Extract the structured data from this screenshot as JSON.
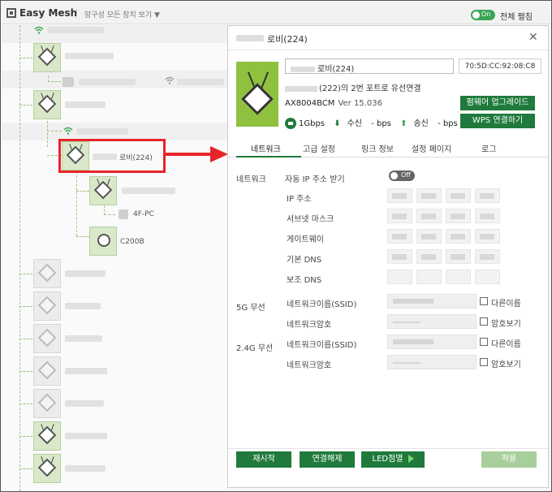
{
  "app": {
    "title": "Easy Mesh",
    "filter_label": "망구성 모든 장치 보기 ▼",
    "toggle_label": "On",
    "expand_all_label": "전체 펼침"
  },
  "tree": {
    "selected_label": "로비(224)",
    "child_label_1": "4F-PC",
    "child_label_2": "C200B"
  },
  "panel": {
    "title": "로비(224)",
    "device_name": "로비(224)",
    "mac": "70:5D:CC:92:08:C8",
    "connection": "(222)의 2번 포트로 유선연결",
    "model": "AX8004BCM",
    "version": "Ver 15.036",
    "firmware_button": "펌웨어 업그레이드",
    "wps_button": "WPS 연결하기",
    "speed": "1Gbps",
    "rx_label": "수신",
    "rx_value": "- bps",
    "tx_label": "송신",
    "tx_value": "- bps",
    "close_icon": "close-icon"
  },
  "tabs": [
    "네트워크",
    "고급 설정",
    "링크 정보",
    "설정 페이지",
    "로그"
  ],
  "network": {
    "section_label": "네트워크",
    "auto_ip_label": "자동 IP 주소 받기",
    "auto_ip_toggle": "Off",
    "ip_label": "IP 주소",
    "subnet_label": "서브넷 마스크",
    "gateway_label": "게이트웨이",
    "dns1_label": "기본 DNS",
    "dns2_label": "보조 DNS"
  },
  "wifi5g": {
    "section_label": "5G 무선",
    "ssid_label": "네트워크이름(SSID)",
    "password_label": "네트워크암호",
    "other_name_label": "다른이름",
    "show_password_label": "암호보기"
  },
  "wifi24g": {
    "section_label": "2.4G 무선",
    "ssid_label": "네트워크이름(SSID)",
    "password_label": "네트워크암호",
    "other_name_label": "다른이름",
    "show_password_label": "암호보기"
  },
  "footer": {
    "restart": "재시작",
    "disconnect": "연결해제",
    "led_blink": "LED점멸",
    "apply": "적용"
  },
  "colors": {
    "accent": "#1f7a3c",
    "device_green": "#8fc13f",
    "highlight_red": "#e8242b"
  }
}
